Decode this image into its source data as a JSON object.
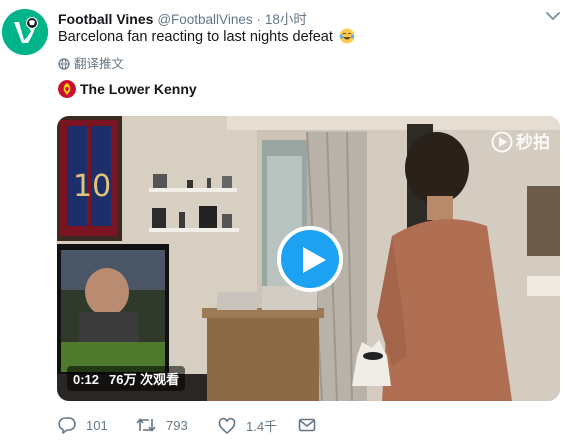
{
  "tweet": {
    "author_name": "Football Vines",
    "author_handle": "@FootballVines",
    "separator": "·",
    "time": "18小时",
    "text": "Barcelona fan reacting to last nights defeat",
    "translate_label": "翻译推文",
    "attribution": "The Lower Kenny"
  },
  "video": {
    "watermark": "秒拍",
    "duration": "0:12",
    "views": "76万 次观看"
  },
  "actions": {
    "replies": "101",
    "retweets": "793",
    "likes": "1.4千"
  },
  "icons": {
    "avatar": "vine-logo-icon",
    "caret": "chevron-down-icon",
    "emoji": "tears-of-joy-emoji-icon",
    "translate": "globe-icon",
    "attribution": "liverpool-crest-icon",
    "play": "play-icon",
    "watermark": "miaopai-logo-icon",
    "reply": "reply-icon",
    "retweet": "retweet-icon",
    "like": "heart-icon",
    "dm": "envelope-icon"
  },
  "colors": {
    "accent": "#1da1f2",
    "avatar_bg": "#00b489",
    "muted": "#657786"
  }
}
